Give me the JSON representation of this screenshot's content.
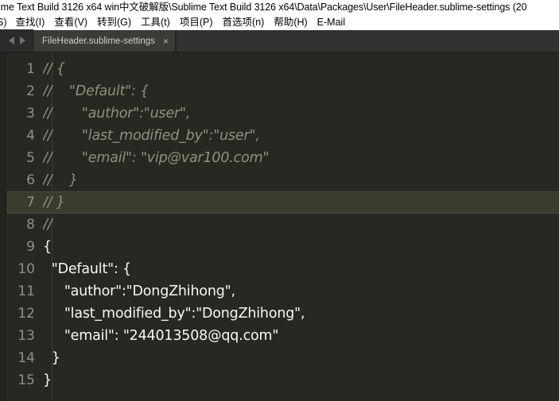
{
  "window": {
    "title": "ime Text Build 3126 x64  win中文破解版\\Sublime Text Build 3126 x64\\Data\\Packages\\User\\FileHeader.sublime-settings (20"
  },
  "menubar": {
    "items": [
      {
        "label": "S)",
        "clipped": true
      },
      {
        "label": "查找(I)",
        "clipped": false
      },
      {
        "label": "查看(V)",
        "clipped": false
      },
      {
        "label": "转到(G)",
        "clipped": false
      },
      {
        "label": "工具(t)",
        "clipped": false
      },
      {
        "label": "项目(P)",
        "clipped": false
      },
      {
        "label": "首选项(n)",
        "clipped": false
      },
      {
        "label": "帮助(H)",
        "clipped": false
      },
      {
        "label": "E-Mail",
        "clipped": false
      }
    ]
  },
  "tabbar": {
    "prev_icon": "arrow-left-icon",
    "next_icon": "arrow-right-icon",
    "tabs": [
      {
        "title": "FileHeader.sublime-settings",
        "close_label": "×",
        "active": true
      }
    ]
  },
  "editor": {
    "theme_background": "#272822",
    "highlight_color": "#3b3c2e",
    "comment_color": "#90917c",
    "text_color": "#f8f8f2",
    "gutter_color": "#8f908a",
    "current_line": 7,
    "lines": [
      {
        "number": "1",
        "text": "// {",
        "comment": true,
        "highlight": false
      },
      {
        "number": "2",
        "text": "//    \"Default\": {",
        "comment": true,
        "highlight": false
      },
      {
        "number": "3",
        "text": "//       \"author\":\"user\",",
        "comment": true,
        "highlight": false
      },
      {
        "number": "4",
        "text": "//       \"last_modified_by\":\"user\",",
        "comment": true,
        "highlight": false
      },
      {
        "number": "5",
        "text": "//       \"email\": \"vip@var100.com\"",
        "comment": true,
        "highlight": false
      },
      {
        "number": "6",
        "text": "//    }",
        "comment": true,
        "highlight": false
      },
      {
        "number": "7",
        "text": "// }",
        "comment": true,
        "highlight": true
      },
      {
        "number": "8",
        "text": "//",
        "comment": true,
        "highlight": false
      },
      {
        "number": "9",
        "text": "{",
        "comment": false,
        "highlight": false
      },
      {
        "number": "10",
        "text": "  \"Default\": {",
        "comment": false,
        "highlight": false
      },
      {
        "number": "11",
        "text": "     \"author\":\"DongZhihong\",",
        "comment": false,
        "highlight": false
      },
      {
        "number": "12",
        "text": "     \"last_modified_by\":\"DongZhihong\",",
        "comment": false,
        "highlight": false
      },
      {
        "number": "13",
        "text": "     \"email\": \"244013508@qq.com\"",
        "comment": false,
        "highlight": false
      },
      {
        "number": "14",
        "text": "  }",
        "comment": false,
        "highlight": false
      },
      {
        "number": "15",
        "text": "}",
        "comment": false,
        "highlight": false
      }
    ]
  }
}
